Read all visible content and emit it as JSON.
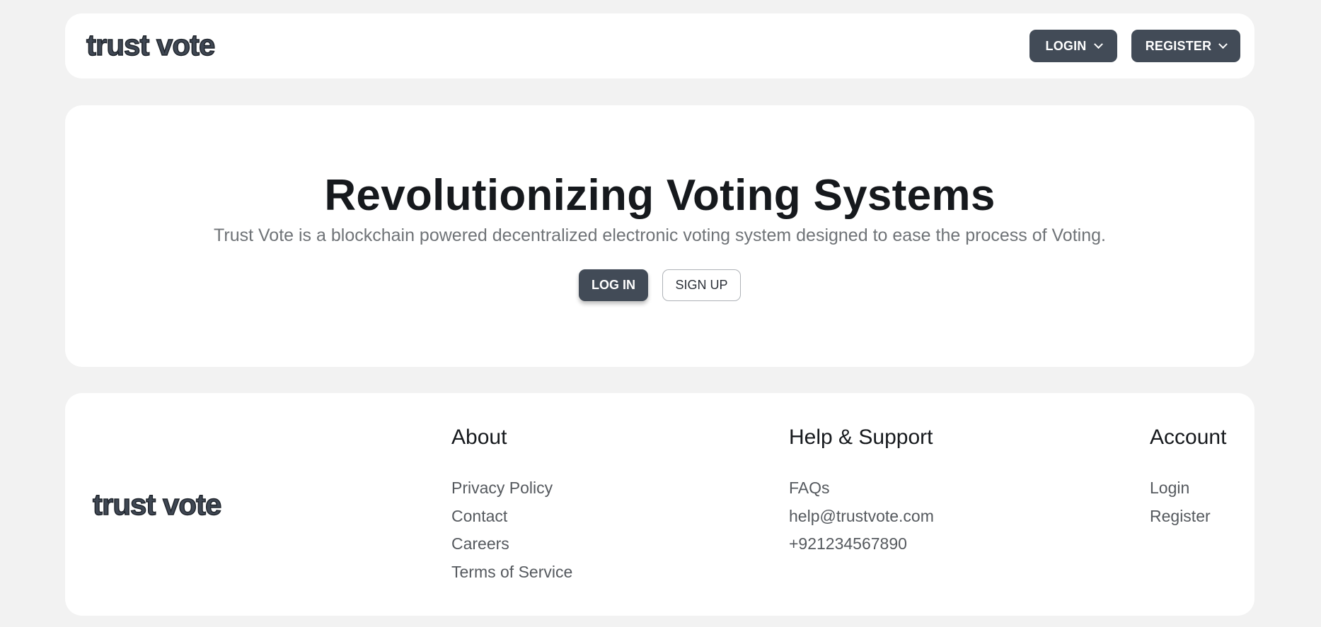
{
  "header": {
    "logo": "trust vote",
    "login_label": "LOGIN",
    "register_label": "REGISTER"
  },
  "hero": {
    "title": "Revolutionizing Voting Systems",
    "subtitle": "Trust Vote is a blockchain powered decentralized electronic voting system designed to ease the process of Voting.",
    "login_button": "LOG IN",
    "signup_button": "SIGN UP"
  },
  "footer": {
    "logo": "trust vote",
    "columns": [
      {
        "title": "About",
        "links": [
          "Privacy Policy",
          "Contact",
          "Careers",
          "Terms of Service"
        ]
      },
      {
        "title": "Help & Support",
        "links": [
          "FAQs",
          "help@trustvote.com",
          "+921234567890"
        ]
      },
      {
        "title": "Account",
        "links": [
          "Login",
          "Register"
        ]
      }
    ]
  },
  "colors": {
    "background": "#f2f2f2",
    "card": "#ffffff",
    "primary_button": "#424b57",
    "heading": "#16191d",
    "muted_text": "#6f7377"
  },
  "icons": {
    "dropdown": "chevron-down-icon"
  }
}
